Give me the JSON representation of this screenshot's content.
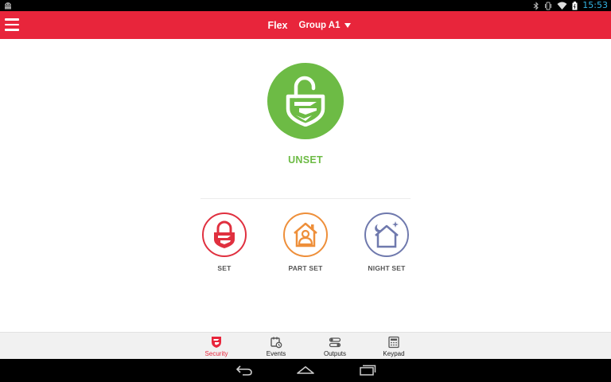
{
  "status_bar": {
    "time": "15:53",
    "icons": [
      "android-icon",
      "bluetooth-icon",
      "vibrate-icon",
      "wifi-icon",
      "battery-icon"
    ]
  },
  "header": {
    "menu_icon": "hamburger-icon",
    "title": "Flex",
    "group": "Group A1",
    "dropdown_icon": "caret-down-icon",
    "color": "#e8253b"
  },
  "status": {
    "label": "UNSET",
    "icon": "unlocked-padlock-shield-icon",
    "color": "#6dbb45"
  },
  "actions": [
    {
      "label": "SET",
      "icon": "padlock-icon",
      "color": "#e0303f"
    },
    {
      "label": "PART SET",
      "icon": "house-person-icon",
      "color": "#ee8f3a"
    },
    {
      "label": "NIGHT SET",
      "icon": "house-moon-icon",
      "color": "#6f79ad"
    }
  ],
  "bottom_nav": [
    {
      "label": "Security",
      "icon": "shield-icon",
      "active": true
    },
    {
      "label": "Events",
      "icon": "events-calendar-icon",
      "active": false
    },
    {
      "label": "Outputs",
      "icon": "toggles-icon",
      "active": false
    },
    {
      "label": "Keypad",
      "icon": "keypad-icon",
      "active": false
    }
  ],
  "system_nav": [
    "back-icon",
    "home-icon",
    "recents-icon"
  ]
}
